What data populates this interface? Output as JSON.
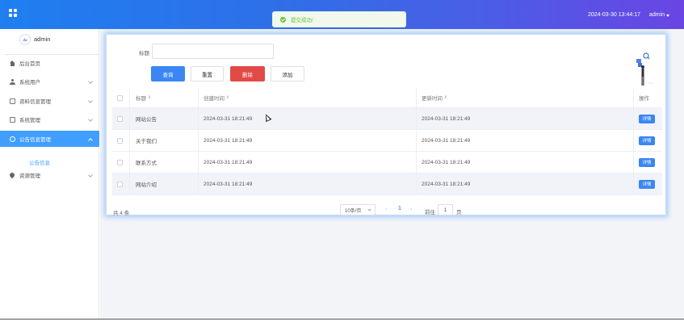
{
  "topbar": {
    "toast": "提交成功!",
    "datetime": "2024-03-30 13:44:17",
    "user": "admin"
  },
  "sidebar": {
    "profile_name": "admin",
    "items": [
      {
        "label": "后台首页",
        "icon": "home-icon"
      },
      {
        "label": "系统用户",
        "icon": "user-icon"
      },
      {
        "label": "资料信息管理",
        "icon": "folder-icon"
      },
      {
        "label": "系统管理",
        "icon": "settings-icon"
      },
      {
        "label": "公告信息管理",
        "icon": "info-icon"
      },
      {
        "label": "资源管理",
        "icon": "location-icon"
      }
    ],
    "sub_item": "公告信息"
  },
  "filter": {
    "title_label": "标题",
    "title_value": "",
    "query_label": "查询",
    "reset_label": "重置",
    "delete_label": "删除",
    "add_label": "添加"
  },
  "table": {
    "headers": {
      "title": "标题",
      "created": "创建时间",
      "updated": "更新时间",
      "actions": "操作"
    },
    "rows": [
      {
        "title": "网站公告",
        "created": "2024-03-31 18:21:49",
        "updated": "2024-03-31 18:21:49",
        "action": "详情"
      },
      {
        "title": "关于我们",
        "created": "2024-03-31 18:21:49",
        "updated": "2024-03-31 18:21:49",
        "action": "详情"
      },
      {
        "title": "联系方式",
        "created": "2024-03-31 18:21:49",
        "updated": "2024-03-31 18:21:49",
        "action": "详情"
      },
      {
        "title": "网站介绍",
        "created": "2024-03-31 18:21:49",
        "updated": "2024-03-31 18:21:49",
        "action": "详情"
      }
    ]
  },
  "pagination": {
    "total": "共 4 条",
    "page_size": "10条/页",
    "current_page": "1",
    "goto_label": "前往",
    "goto_value": "1",
    "goto_suffix": "页"
  },
  "colors": {
    "primary": "#409eff",
    "danger": "#e04b47",
    "success": "#67c23a"
  }
}
